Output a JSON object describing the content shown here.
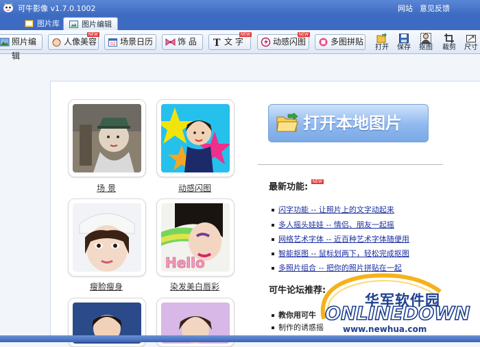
{
  "window": {
    "title": "可牛影像 v1.7.0.1002",
    "links": [
      "网站",
      "意见反馈"
    ]
  },
  "tabs": [
    {
      "label": "图片库",
      "active": false
    },
    {
      "label": "图片编辑",
      "active": true
    }
  ],
  "toolbar": {
    "buttons": [
      {
        "label": "照片编辑",
        "icon": "photo-edit-icon"
      },
      {
        "label": "人像美容",
        "icon": "face-icon",
        "new_badge": "NEW"
      },
      {
        "label": "场景日历",
        "icon": "calendar-icon"
      },
      {
        "label": "饰 品",
        "icon": "bow-icon"
      },
      {
        "label": "文 字",
        "icon": "text-icon",
        "new_badge": "NEW"
      },
      {
        "label": "动感闪图",
        "icon": "animation-icon",
        "new_badge": "NEW"
      },
      {
        "label": "多图拼贴",
        "icon": "collage-icon"
      }
    ],
    "tools": [
      {
        "label": "打开",
        "icon": "open-icon"
      },
      {
        "label": "保存",
        "icon": "save-icon"
      },
      {
        "label": "抠图",
        "icon": "cutout-icon"
      },
      {
        "label": "裁剪",
        "icon": "crop-icon"
      },
      {
        "label": "尺寸",
        "icon": "resize-icon"
      }
    ]
  },
  "thumbnails": [
    {
      "label": "场 景"
    },
    {
      "label": "动感闪图"
    },
    {
      "label": "瘦脸瘦身"
    },
    {
      "label": "染发美白唇彩"
    }
  ],
  "open_button": {
    "label": "打开本地图片"
  },
  "features": {
    "title": "最新功能:",
    "badge": "NEW",
    "items": [
      "闪字功能 -- 让照片上的文字动起来",
      "多人摇头娃娃 -- 情侣、朋友一起摇",
      "网络艺术字体 -- 近百种艺术字体随便用",
      "智能抠图 -- 鼠标划两下，轻松完成抠图",
      "多照片组合 -- 把你的照片拼贴在一起"
    ]
  },
  "forum": {
    "title": "可牛论坛推荐:",
    "items": [
      "教你用可牛",
      "制作的诱惑摇"
    ]
  },
  "watermark": {
    "cn": "华军软件园",
    "logo": "ONLINEDOWN",
    "url": "www.newhua.com"
  },
  "colors": {
    "title_bar": "#3d6bc1",
    "link": "#1a2ea0",
    "open_button": "#8fb8ee",
    "watermark": "#1d3f8f"
  }
}
